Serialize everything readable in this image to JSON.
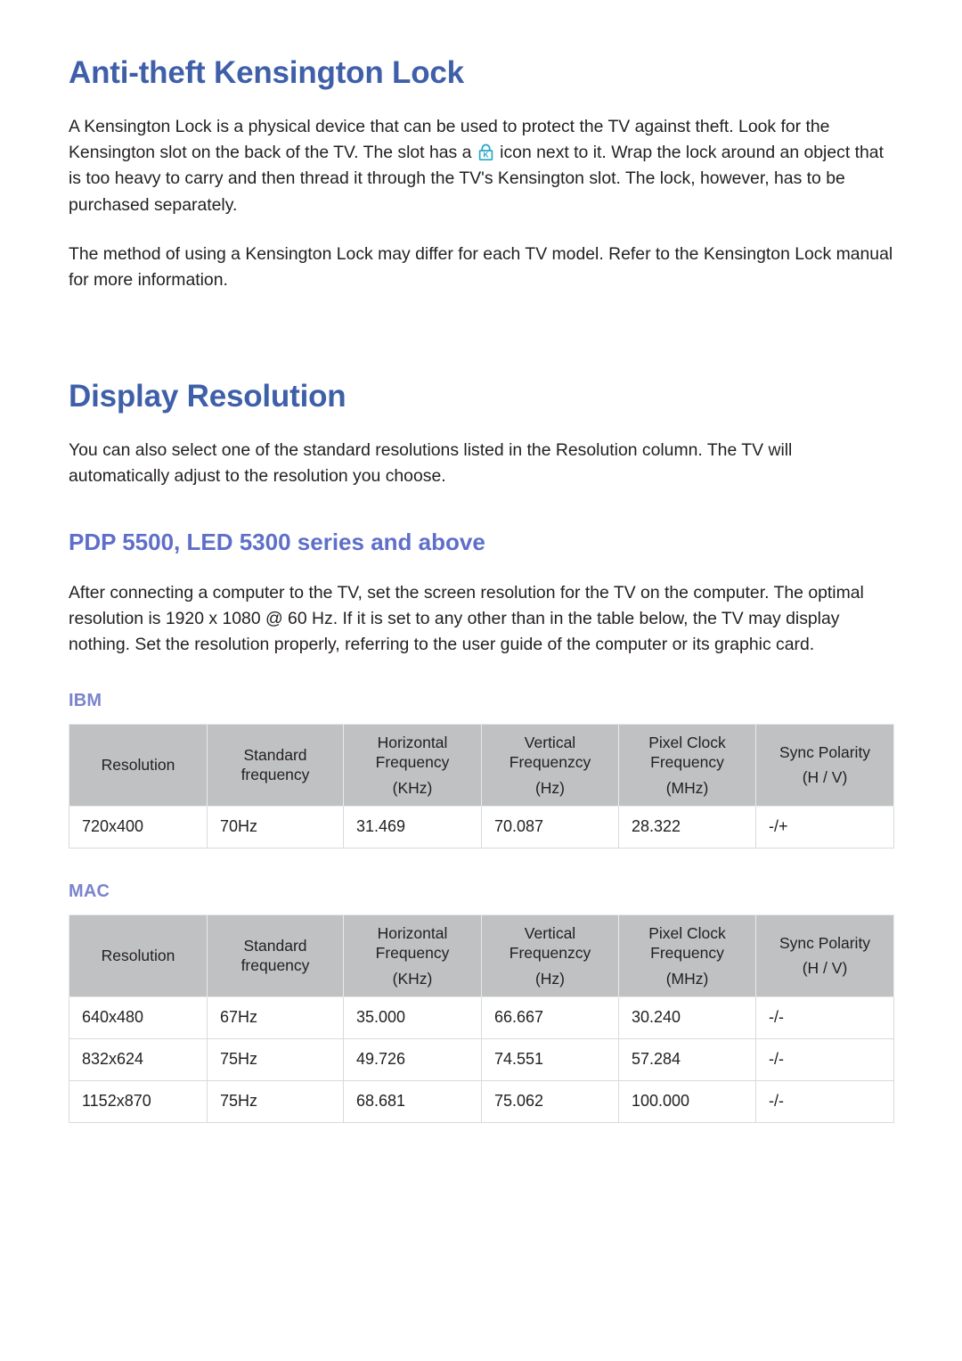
{
  "document": {
    "sections": [
      {
        "id": "anti-theft",
        "heading": "Anti-theft Kensington Lock",
        "paragraphs": [
          {
            "before_icon": "A Kensington Lock is a physical device that can be used to protect the TV against theft. Look for the Kensington slot on the back of the TV. The slot has a ",
            "icon": "kensington-lock-icon",
            "after_icon": " icon next to it. Wrap the lock around an object that is too heavy to carry and then thread it through the TV's Kensington slot. The lock, however, has to be purchased separately."
          },
          {
            "text": "The method of using a Kensington Lock may differ for each TV model. Refer to the Kensington Lock manual for more information."
          }
        ]
      },
      {
        "id": "display-resolution",
        "heading": "Display Resolution",
        "intro": "You can also select one of the standard resolutions listed in the Resolution column. The TV will automatically adjust to the resolution you choose.",
        "subheading": "PDP 5500, LED 5300 series and above",
        "sub_intro": "After connecting a computer to the TV, set the screen resolution for the TV on the computer. The optimal resolution is 1920 x 1080 @ 60 Hz. If it is set to any other than in the table below, the TV may display nothing. Set the resolution properly, referring to the user guide of the computer or its graphic card."
      }
    ]
  },
  "tables": {
    "columns": [
      {
        "label": "Resolution",
        "unit": ""
      },
      {
        "label": "Standard frequency",
        "unit": ""
      },
      {
        "label": "Horizontal Frequency",
        "unit": "(KHz)"
      },
      {
        "label": "Vertical Frequenzcy",
        "unit": "(Hz)"
      },
      {
        "label": "Pixel Clock Frequency",
        "unit": "(MHz)"
      },
      {
        "label": "Sync Polarity",
        "unit": "(H / V)"
      }
    ],
    "ibm": {
      "title": "IBM",
      "rows": [
        [
          "720x400",
          "70Hz",
          "31.469",
          "70.087",
          "28.322",
          "-/+"
        ]
      ]
    },
    "mac": {
      "title": "MAC",
      "rows": [
        [
          "640x480",
          "67Hz",
          "35.000",
          "66.667",
          "30.240",
          "-/-"
        ],
        [
          "832x624",
          "75Hz",
          "49.726",
          "74.551",
          "57.284",
          "-/-"
        ],
        [
          "1152x870",
          "75Hz",
          "68.681",
          "75.062",
          "100.000",
          "-/-"
        ]
      ]
    }
  },
  "colors": {
    "heading": "#3f60a9",
    "subheading": "#5f6fc9",
    "section_label": "#7b83cd",
    "body_text": "#231f20",
    "table_header_bg": "#bfc1c3",
    "icon_accent": "#2aa8c6",
    "page_bg": "#ffffff"
  }
}
